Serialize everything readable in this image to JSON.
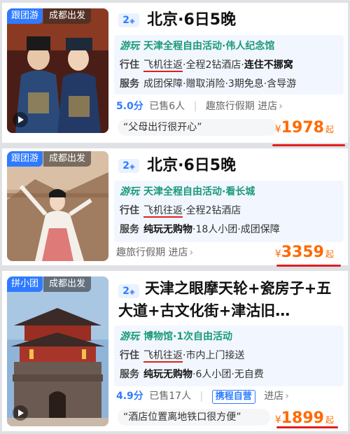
{
  "cards": [
    {
      "type_tag": "跟团游",
      "from_tag": "成都出发",
      "badge": "2",
      "title": "北京·6日5晚",
      "play_label": "游玩",
      "play_text": "天津全程自由活动·伟人纪念馆",
      "travel_label": "行住",
      "travel_transport": "飞机往返",
      "travel_rest": "·全程2钻酒店·",
      "travel_bold": "连住不挪窝",
      "service_label": "服务",
      "service_text": "成团保障·赠取消险·3期免息·含导游",
      "score": "5.0分",
      "sold": "已售6人",
      "shop": "趣旅行假期 进店",
      "quote": "“父母出行很开心”",
      "currency": "¥",
      "price": "1978",
      "price_suffix": "起"
    },
    {
      "type_tag": "跟团游",
      "from_tag": "成都出发",
      "badge": "2",
      "title": "北京·6日5晚",
      "play_label": "游玩",
      "play_text": "天津全程自由活动·看长城",
      "travel_label": "行住",
      "travel_transport": "飞机往返",
      "travel_rest": "·全程2钻酒店",
      "service_label": "服务",
      "service_bold": "纯玩无购物",
      "service_text": "·18人小团·成团保障",
      "shop": "趣旅行假期 进店",
      "currency": "¥",
      "price": "3359",
      "price_suffix": "起"
    },
    {
      "type_tag": "拼小团",
      "from_tag": "成都出发",
      "badge": "2",
      "title": "天津之眼摩天轮+瓷房子+五大道+古文化街+津沽旧…",
      "play_label": "游玩",
      "play_text": "博物馆·1次自由活动",
      "travel_label": "行住",
      "travel_transport": "飞机往返",
      "travel_rest": "·市内上门接送",
      "service_label": "服务",
      "service_bold": "纯玩无购物",
      "service_text": "·6人小团·无自费",
      "score": "4.9分",
      "sold": "已售17人",
      "ctrip_badge": "携程自营",
      "shop": "进店",
      "quote": "“酒店位置离地铁口很方便”",
      "currency": "¥",
      "price": "1899",
      "price_suffix": "起"
    }
  ],
  "colors": {
    "accent_blue": "#2f7bff",
    "price_orange": "#ff6a00",
    "mark_red": "#e02020",
    "play_green": "#1a9a7a"
  }
}
